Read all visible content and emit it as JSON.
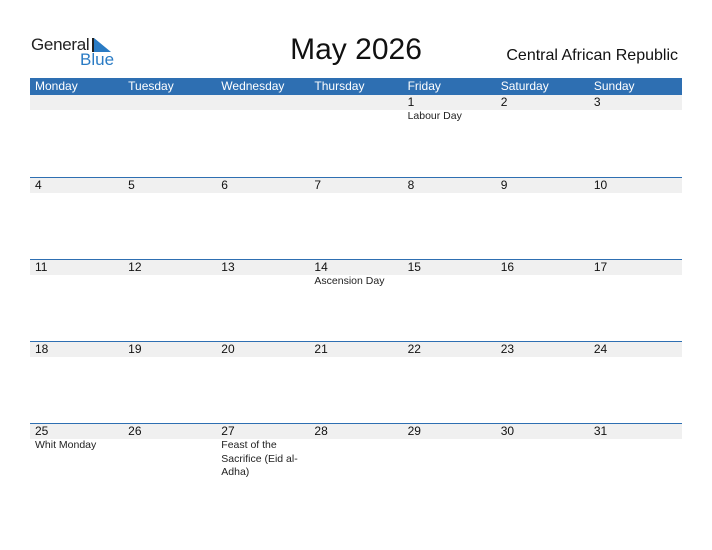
{
  "logo": {
    "word1": "General",
    "word2": "Blue"
  },
  "title": "May 2026",
  "country": "Central African Republic",
  "colors": {
    "header_bg": "#2e6fb2",
    "brand_blue": "#2a7bc4",
    "day_row_bg": "#f0f0f0"
  },
  "weekdays": [
    "Monday",
    "Tuesday",
    "Wednesday",
    "Thursday",
    "Friday",
    "Saturday",
    "Sunday"
  ],
  "weeks": [
    {
      "days": [
        "",
        "",
        "",
        "",
        "1",
        "2",
        "3"
      ],
      "holidays": [
        "",
        "",
        "",
        "",
        "Labour Day",
        "",
        ""
      ]
    },
    {
      "days": [
        "4",
        "5",
        "6",
        "7",
        "8",
        "9",
        "10"
      ],
      "holidays": [
        "",
        "",
        "",
        "",
        "",
        "",
        ""
      ]
    },
    {
      "days": [
        "11",
        "12",
        "13",
        "14",
        "15",
        "16",
        "17"
      ],
      "holidays": [
        "",
        "",
        "",
        "Ascension Day",
        "",
        "",
        ""
      ]
    },
    {
      "days": [
        "18",
        "19",
        "20",
        "21",
        "22",
        "23",
        "24"
      ],
      "holidays": [
        "",
        "",
        "",
        "",
        "",
        "",
        ""
      ]
    },
    {
      "days": [
        "25",
        "26",
        "27",
        "28",
        "29",
        "30",
        "31"
      ],
      "holidays": [
        "Whit Monday",
        "",
        "Feast of the Sacrifice (Eid al-Adha)",
        "",
        "",
        "",
        ""
      ]
    }
  ]
}
